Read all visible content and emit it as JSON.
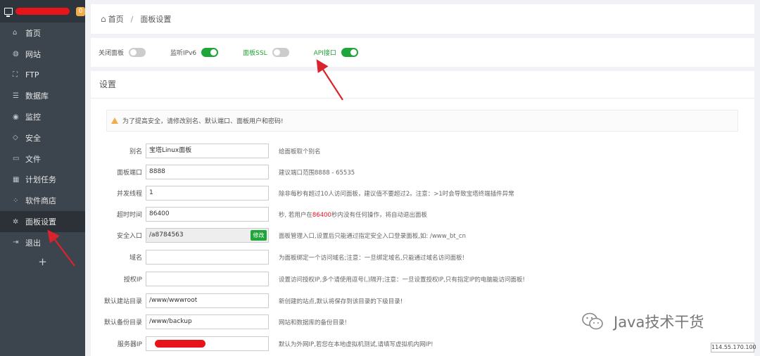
{
  "sidebar": {
    "badge": "0",
    "items": [
      {
        "label": "首页",
        "icon": "home-icon"
      },
      {
        "label": "网站",
        "icon": "globe-icon"
      },
      {
        "label": "FTP",
        "icon": "ftp-icon"
      },
      {
        "label": "数据库",
        "icon": "database-icon"
      },
      {
        "label": "监控",
        "icon": "monitor-icon"
      },
      {
        "label": "安全",
        "icon": "shield-icon"
      },
      {
        "label": "文件",
        "icon": "folder-icon"
      },
      {
        "label": "计划任务",
        "icon": "calendar-icon"
      },
      {
        "label": "软件商店",
        "icon": "apps-icon"
      },
      {
        "label": "面板设置",
        "icon": "gear-icon",
        "active": true
      },
      {
        "label": "退出",
        "icon": "logout-icon"
      }
    ],
    "add": "+"
  },
  "breadcrumb": {
    "home": "首页",
    "sep": "/",
    "current": "面板设置"
  },
  "toggles": [
    {
      "label": "关闭面板",
      "on": false
    },
    {
      "label": "监听IPv6",
      "on": true
    },
    {
      "label": "面板SSL",
      "on": false
    },
    {
      "label": "API接口",
      "on": true
    }
  ],
  "settings": {
    "title": "设置",
    "warning": "为了提高安全，请修改别名、默认端口、面板用户和密码!",
    "edit_label": "修改",
    "fields": [
      {
        "label": "别名",
        "value": "宝塔Linux面板",
        "hint": "给面板取个别名"
      },
      {
        "label": "面板端口",
        "value": "8888",
        "hint": "建议端口范围8888 - 65535"
      },
      {
        "label": "并发线程",
        "value": "1",
        "hint": "除非每秒有超过10人访问面板，建议值不要超过2。注意：>1时会导致宝塔终端插件异常"
      },
      {
        "label": "超时时间",
        "value": "86400",
        "hint_pre": "秒, 若用户在",
        "hint_red": "86400",
        "hint_post": "秒内没有任何操作，将自动退出面板"
      },
      {
        "label": "安全入口",
        "value": "/a8784563",
        "hint": "面板管理入口,设置后只能通过指定安全入口登录面板,如: /www_bt_cn"
      },
      {
        "label": "域名",
        "value": "",
        "hint": "为面板绑定一个访问域名;注意：一旦绑定域名,只能通过域名访问面板!"
      },
      {
        "label": "授权IP",
        "value": "",
        "hint": "设置访问授权IP,多个请使用逗号(,)隔开;注意：一旦设置授权IP,只有指定IP的电脑能访问面板!"
      },
      {
        "label": "默认建站目录",
        "value": "/www/wwwroot",
        "hint": "新创建的站点,默认将保存到该目录的下级目录!"
      },
      {
        "label": "默认备份目录",
        "value": "/www/backup",
        "hint": "网站和数据库的备份目录!"
      },
      {
        "label": "服务器IP",
        "value": "",
        "hint": "默认为外网IP,若您在本地虚拟机测试,请填写虚拟机内网IP!"
      }
    ]
  },
  "watermark": "Java技术干货",
  "ip_tooltip": "114.55.170.100",
  "colors": {
    "accent": "#20a53a",
    "sidebar": "#3c444d",
    "annotation": "#d9232d"
  }
}
